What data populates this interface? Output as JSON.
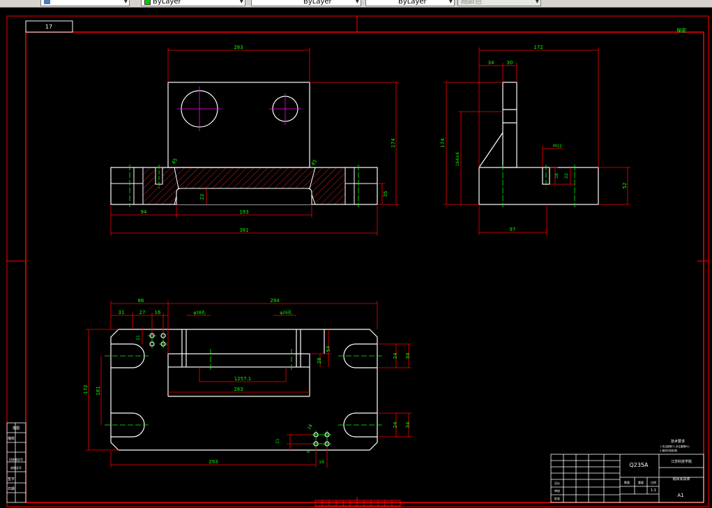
{
  "toolbar": {
    "linetype_combo": "ByLayer",
    "lineweight_combo": "ByLayer",
    "color_combo": "ByLayer",
    "plotstyle_combo": "随颜色"
  },
  "drawing": {
    "sheet_tag": "17",
    "top_right_mark": "保密",
    "front_view": {
      "dim_top_width": "283",
      "dim_left_width": "94",
      "dim_mid_width": "193",
      "dim_overall_width": "381",
      "dim_height": "174",
      "dim_step_height": "35",
      "dim_slot_depth": "22",
      "dim_left_angle": "45",
      "dim_right_angle": "45"
    },
    "side_view": {
      "dim_overall_width": "172",
      "dim_upright_offset": "34",
      "dim_upright_width": "30",
      "dim_height_outer": "174",
      "dim_height_inner": "164±6",
      "dim_thread": "M12",
      "dim_hole_a": "18",
      "dim_hole_b": "22",
      "dim_base_height": "52",
      "dim_base_width": "97"
    },
    "top_view": {
      "dim_offset_86": "86",
      "dim_overall_294": "294",
      "dim_31": "31",
      "dim_27": "27",
      "dim_16": "16",
      "dim_hole_left": "φ38孔",
      "dim_hole_right": "φ26孔",
      "dim_21": "21",
      "dim_54": "54",
      "dim_28": "28",
      "dim_24_top": "24",
      "dim_34_top": "34",
      "dim_24_bottom": "24",
      "dim_34_bottom": "34",
      "dim_172": "172",
      "dim_181": "181",
      "dim_1257": "1257.1",
      "dim_283": "283",
      "dim_293": "293",
      "dim_16_bottom": "16",
      "dim_21_bottom": "21",
      "dim_6_bottom": "6",
      "dim_18_bottom": "18"
    },
    "title_block": {
      "material": "Q235A",
      "school": "江苏科技学院",
      "part_name": "铣床夹具体",
      "scale": "1:1",
      "drawn_by": "设计",
      "checked_by": "审核",
      "approved_by": "批准",
      "notes_title": "技术要求",
      "note_1": "1.未注倒角C1,未注圆角R2。",
      "note_2": "2.铸件时效处理。",
      "sheet_text": "A1",
      "label_quantity": "数量",
      "label_weight": "重量",
      "label_ratio": "比例"
    },
    "side_strip": {
      "row1": "描图",
      "row2": "描校",
      "row3": "旧底图总号",
      "row4": "底图总号",
      "row5": "签字",
      "row6": "日期"
    },
    "colors": {
      "border": "#ff0000",
      "object": "#ffffff",
      "dimension": "#00ff00",
      "centerline": "#ff00ff",
      "hatch": "#ff3030",
      "hidden": "#ffff00"
    }
  }
}
